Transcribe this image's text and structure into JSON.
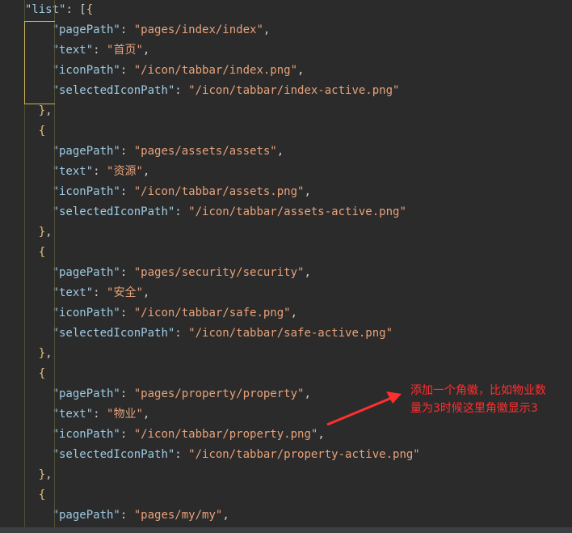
{
  "editor": {
    "lines": [
      {
        "indent": 2,
        "tokens": [
          [
            "key",
            "\"list\""
          ],
          [
            "punc",
            ": ["
          ],
          [
            "brace",
            "{"
          ]
        ]
      },
      {
        "indent": 6,
        "tokens": [
          [
            "key",
            "\"pagePath\""
          ],
          [
            "punc",
            ": "
          ],
          [
            "str",
            "\"pages/index/index\""
          ],
          [
            "punc",
            ","
          ]
        ]
      },
      {
        "indent": 6,
        "tokens": [
          [
            "key",
            "\"text\""
          ],
          [
            "punc",
            ": "
          ],
          [
            "str",
            "\"首页\""
          ],
          [
            "punc",
            ","
          ]
        ]
      },
      {
        "indent": 6,
        "tokens": [
          [
            "key",
            "\"iconPath\""
          ],
          [
            "punc",
            ": "
          ],
          [
            "str",
            "\"/icon/tabbar/index.png\""
          ],
          [
            "punc",
            ","
          ]
        ]
      },
      {
        "indent": 6,
        "tokens": [
          [
            "key",
            "\"selectedIconPath\""
          ],
          [
            "punc",
            ": "
          ],
          [
            "str",
            "\"/icon/tabbar/index-active.png\""
          ]
        ]
      },
      {
        "indent": 4,
        "tokens": [
          [
            "brace",
            "}"
          ],
          [
            "punc",
            ","
          ]
        ]
      },
      {
        "indent": 4,
        "tokens": [
          [
            "brace",
            "{"
          ]
        ]
      },
      {
        "indent": 6,
        "tokens": [
          [
            "key",
            "\"pagePath\""
          ],
          [
            "punc",
            ": "
          ],
          [
            "str",
            "\"pages/assets/assets\""
          ],
          [
            "punc",
            ","
          ]
        ]
      },
      {
        "indent": 6,
        "tokens": [
          [
            "key",
            "\"text\""
          ],
          [
            "punc",
            ": "
          ],
          [
            "str",
            "\"资源\""
          ],
          [
            "punc",
            ","
          ]
        ]
      },
      {
        "indent": 6,
        "tokens": [
          [
            "key",
            "\"iconPath\""
          ],
          [
            "punc",
            ": "
          ],
          [
            "str",
            "\"/icon/tabbar/assets.png\""
          ],
          [
            "punc",
            ","
          ]
        ]
      },
      {
        "indent": 6,
        "tokens": [
          [
            "key",
            "\"selectedIconPath\""
          ],
          [
            "punc",
            ": "
          ],
          [
            "str",
            "\"/icon/tabbar/assets-active.png\""
          ]
        ]
      },
      {
        "indent": 4,
        "tokens": [
          [
            "brace",
            "}"
          ],
          [
            "punc",
            ","
          ]
        ]
      },
      {
        "indent": 4,
        "tokens": [
          [
            "brace",
            "{"
          ]
        ]
      },
      {
        "indent": 6,
        "tokens": [
          [
            "key",
            "\"pagePath\""
          ],
          [
            "punc",
            ": "
          ],
          [
            "str",
            "\"pages/security/security\""
          ],
          [
            "punc",
            ","
          ]
        ]
      },
      {
        "indent": 6,
        "tokens": [
          [
            "key",
            "\"text\""
          ],
          [
            "punc",
            ": "
          ],
          [
            "str",
            "\"安全\""
          ],
          [
            "punc",
            ","
          ]
        ]
      },
      {
        "indent": 6,
        "tokens": [
          [
            "key",
            "\"iconPath\""
          ],
          [
            "punc",
            ": "
          ],
          [
            "str",
            "\"/icon/tabbar/safe.png\""
          ],
          [
            "punc",
            ","
          ]
        ]
      },
      {
        "indent": 6,
        "tokens": [
          [
            "key",
            "\"selectedIconPath\""
          ],
          [
            "punc",
            ": "
          ],
          [
            "str",
            "\"/icon/tabbar/safe-active.png\""
          ]
        ]
      },
      {
        "indent": 4,
        "tokens": [
          [
            "brace",
            "}"
          ],
          [
            "punc",
            ","
          ]
        ]
      },
      {
        "indent": 4,
        "tokens": [
          [
            "brace",
            "{"
          ]
        ]
      },
      {
        "indent": 6,
        "tokens": [
          [
            "key",
            "\"pagePath\""
          ],
          [
            "punc",
            ": "
          ],
          [
            "str",
            "\"pages/property/property\""
          ],
          [
            "punc",
            ","
          ]
        ]
      },
      {
        "indent": 6,
        "tokens": [
          [
            "key",
            "\"text\""
          ],
          [
            "punc",
            ": "
          ],
          [
            "str",
            "\"物业\""
          ],
          [
            "punc",
            ","
          ]
        ]
      },
      {
        "indent": 6,
        "tokens": [
          [
            "key",
            "\"iconPath\""
          ],
          [
            "punc",
            ": "
          ],
          [
            "str",
            "\"/icon/tabbar/property.png\""
          ],
          [
            "punc",
            ","
          ]
        ]
      },
      {
        "indent": 6,
        "tokens": [
          [
            "key",
            "\"selectedIconPath\""
          ],
          [
            "punc",
            ": "
          ],
          [
            "str",
            "\"/icon/tabbar/property-active.png\""
          ]
        ]
      },
      {
        "indent": 4,
        "tokens": [
          [
            "brace",
            "}"
          ],
          [
            "punc",
            ","
          ]
        ]
      },
      {
        "indent": 4,
        "tokens": [
          [
            "brace",
            "{"
          ]
        ]
      },
      {
        "indent": 6,
        "tokens": [
          [
            "key",
            "\"pagePath\""
          ],
          [
            "punc",
            ": "
          ],
          [
            "str",
            "\"pages/my/my\""
          ],
          [
            "punc",
            ","
          ]
        ]
      }
    ]
  },
  "annotation": {
    "text": "添加一个角徽，比如物业数量为3时候这里角徽显示3",
    "color": "#ff2f2f"
  }
}
